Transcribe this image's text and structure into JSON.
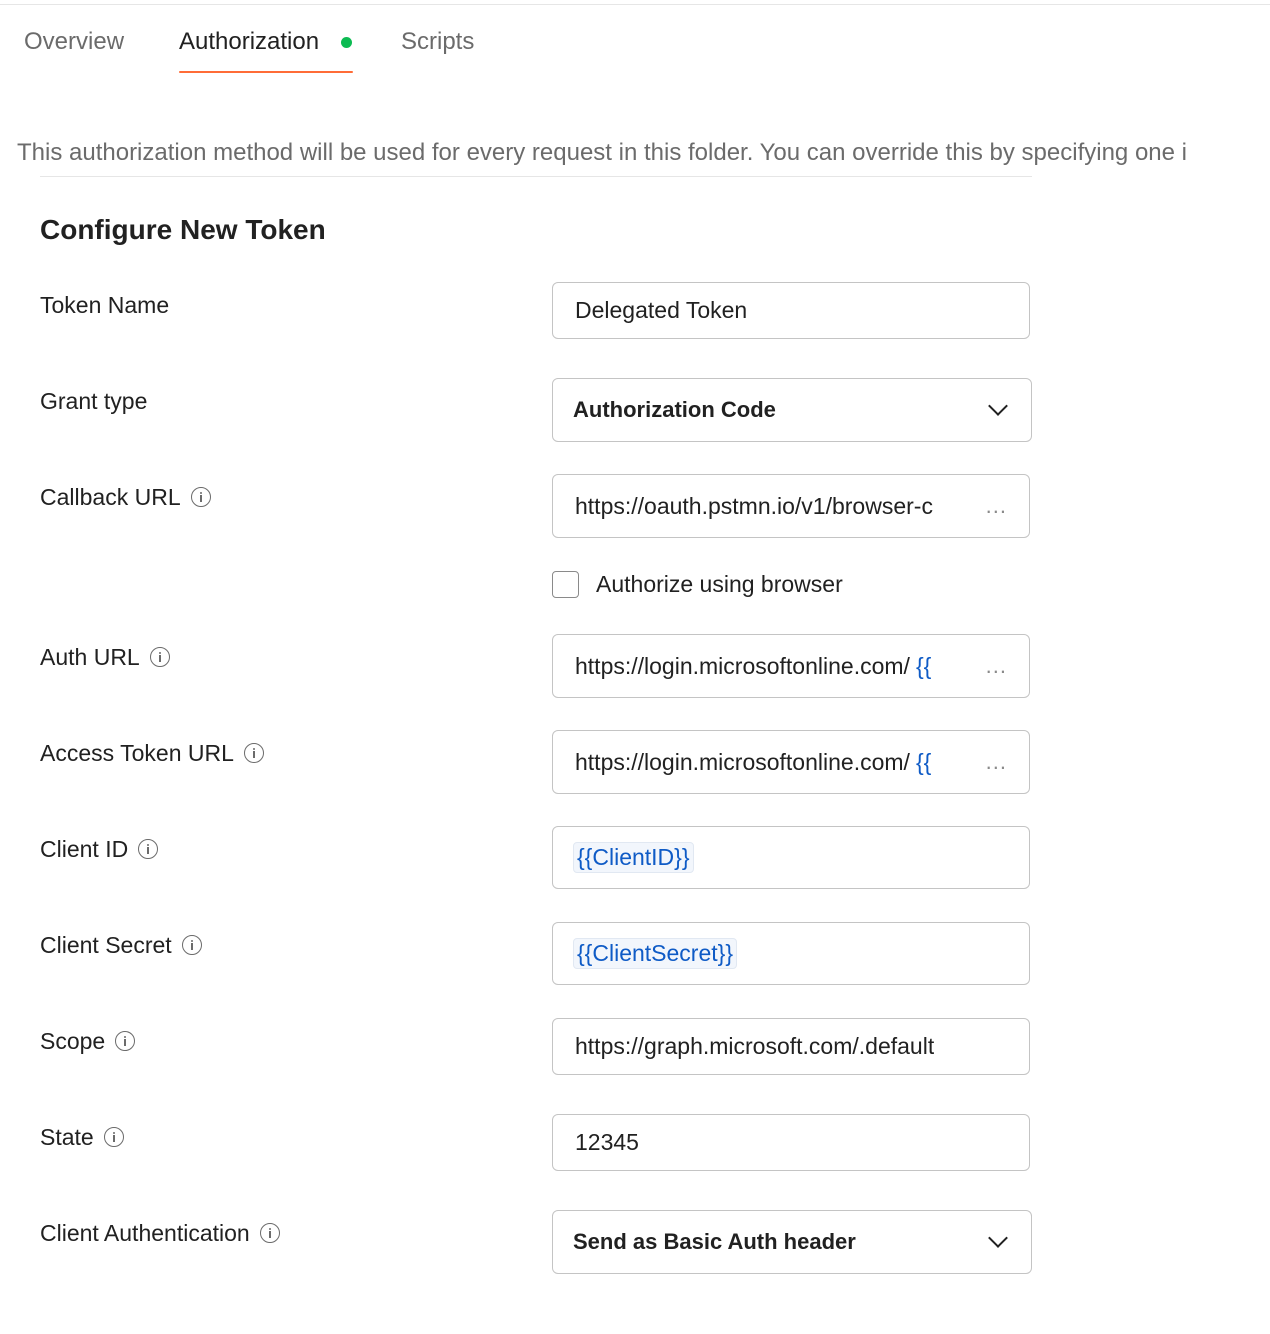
{
  "tabs": [
    {
      "label": "Overview",
      "active": false
    },
    {
      "label": "Authorization",
      "active": true,
      "has_status_dot": true
    },
    {
      "label": "Scripts",
      "active": false
    }
  ],
  "colors": {
    "active_tab_underline": "#ff6c37",
    "status_dot": "#0cbb52",
    "variable_text": "#0f5bc6"
  },
  "description": "This authorization method will be used for every request in this folder. You can override this by specifying one i",
  "section_title": "Configure New Token",
  "form": {
    "token_name": {
      "label": "Token Name",
      "value": "Delegated Token"
    },
    "grant_type": {
      "label": "Grant type",
      "value": "Authorization Code"
    },
    "callback_url": {
      "label": "Callback URL",
      "value": "https://oauth.pstmn.io/v1/browser-c",
      "overflow": "..."
    },
    "authorize_browser": {
      "label": "Authorize using browser",
      "checked": false
    },
    "auth_url": {
      "label": "Auth URL",
      "value": "https://login.microsoftonline.com/",
      "variable": "{{",
      "overflow": "..."
    },
    "access_token_url": {
      "label": "Access Token URL",
      "value": "https://login.microsoftonline.com/",
      "variable": "{{",
      "overflow": "..."
    },
    "client_id": {
      "label": "Client ID",
      "value": "{{ClientID}}"
    },
    "client_secret": {
      "label": "Client Secret",
      "value": "{{ClientSecret}}"
    },
    "scope": {
      "label": "Scope",
      "value": "https://graph.microsoft.com/.default"
    },
    "state": {
      "label": "State",
      "value": "12345"
    },
    "client_authentication": {
      "label": "Client Authentication",
      "value": "Send as Basic Auth header"
    }
  }
}
